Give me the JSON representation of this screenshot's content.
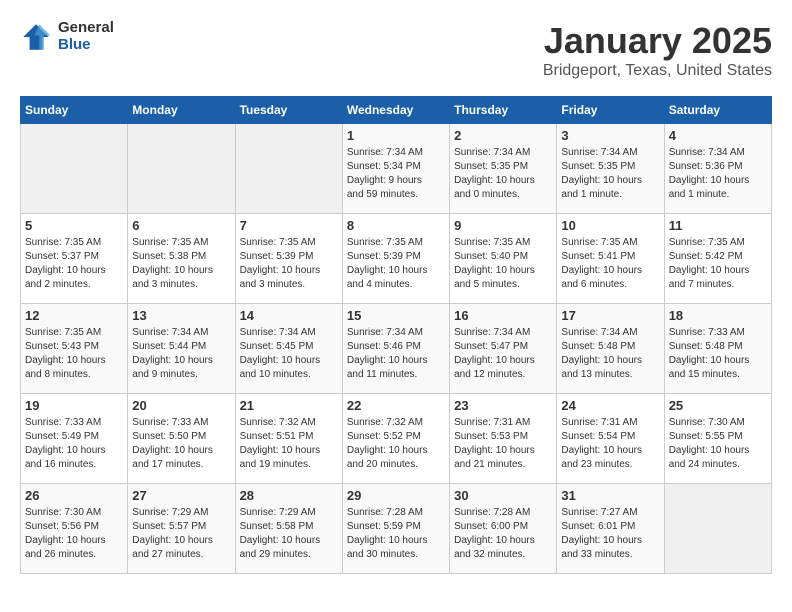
{
  "header": {
    "logo_general": "General",
    "logo_blue": "Blue",
    "title": "January 2025",
    "location": "Bridgeport, Texas, United States"
  },
  "days_of_week": [
    "Sunday",
    "Monday",
    "Tuesday",
    "Wednesday",
    "Thursday",
    "Friday",
    "Saturday"
  ],
  "weeks": [
    [
      {
        "num": "",
        "detail": ""
      },
      {
        "num": "",
        "detail": ""
      },
      {
        "num": "",
        "detail": ""
      },
      {
        "num": "1",
        "detail": "Sunrise: 7:34 AM\nSunset: 5:34 PM\nDaylight: 9 hours\nand 59 minutes."
      },
      {
        "num": "2",
        "detail": "Sunrise: 7:34 AM\nSunset: 5:35 PM\nDaylight: 10 hours\nand 0 minutes."
      },
      {
        "num": "3",
        "detail": "Sunrise: 7:34 AM\nSunset: 5:35 PM\nDaylight: 10 hours\nand 1 minute."
      },
      {
        "num": "4",
        "detail": "Sunrise: 7:34 AM\nSunset: 5:36 PM\nDaylight: 10 hours\nand 1 minute."
      }
    ],
    [
      {
        "num": "5",
        "detail": "Sunrise: 7:35 AM\nSunset: 5:37 PM\nDaylight: 10 hours\nand 2 minutes."
      },
      {
        "num": "6",
        "detail": "Sunrise: 7:35 AM\nSunset: 5:38 PM\nDaylight: 10 hours\nand 3 minutes."
      },
      {
        "num": "7",
        "detail": "Sunrise: 7:35 AM\nSunset: 5:39 PM\nDaylight: 10 hours\nand 3 minutes."
      },
      {
        "num": "8",
        "detail": "Sunrise: 7:35 AM\nSunset: 5:39 PM\nDaylight: 10 hours\nand 4 minutes."
      },
      {
        "num": "9",
        "detail": "Sunrise: 7:35 AM\nSunset: 5:40 PM\nDaylight: 10 hours\nand 5 minutes."
      },
      {
        "num": "10",
        "detail": "Sunrise: 7:35 AM\nSunset: 5:41 PM\nDaylight: 10 hours\nand 6 minutes."
      },
      {
        "num": "11",
        "detail": "Sunrise: 7:35 AM\nSunset: 5:42 PM\nDaylight: 10 hours\nand 7 minutes."
      }
    ],
    [
      {
        "num": "12",
        "detail": "Sunrise: 7:35 AM\nSunset: 5:43 PM\nDaylight: 10 hours\nand 8 minutes."
      },
      {
        "num": "13",
        "detail": "Sunrise: 7:34 AM\nSunset: 5:44 PM\nDaylight: 10 hours\nand 9 minutes."
      },
      {
        "num": "14",
        "detail": "Sunrise: 7:34 AM\nSunset: 5:45 PM\nDaylight: 10 hours\nand 10 minutes."
      },
      {
        "num": "15",
        "detail": "Sunrise: 7:34 AM\nSunset: 5:46 PM\nDaylight: 10 hours\nand 11 minutes."
      },
      {
        "num": "16",
        "detail": "Sunrise: 7:34 AM\nSunset: 5:47 PM\nDaylight: 10 hours\nand 12 minutes."
      },
      {
        "num": "17",
        "detail": "Sunrise: 7:34 AM\nSunset: 5:48 PM\nDaylight: 10 hours\nand 13 minutes."
      },
      {
        "num": "18",
        "detail": "Sunrise: 7:33 AM\nSunset: 5:48 PM\nDaylight: 10 hours\nand 15 minutes."
      }
    ],
    [
      {
        "num": "19",
        "detail": "Sunrise: 7:33 AM\nSunset: 5:49 PM\nDaylight: 10 hours\nand 16 minutes."
      },
      {
        "num": "20",
        "detail": "Sunrise: 7:33 AM\nSunset: 5:50 PM\nDaylight: 10 hours\nand 17 minutes."
      },
      {
        "num": "21",
        "detail": "Sunrise: 7:32 AM\nSunset: 5:51 PM\nDaylight: 10 hours\nand 19 minutes."
      },
      {
        "num": "22",
        "detail": "Sunrise: 7:32 AM\nSunset: 5:52 PM\nDaylight: 10 hours\nand 20 minutes."
      },
      {
        "num": "23",
        "detail": "Sunrise: 7:31 AM\nSunset: 5:53 PM\nDaylight: 10 hours\nand 21 minutes."
      },
      {
        "num": "24",
        "detail": "Sunrise: 7:31 AM\nSunset: 5:54 PM\nDaylight: 10 hours\nand 23 minutes."
      },
      {
        "num": "25",
        "detail": "Sunrise: 7:30 AM\nSunset: 5:55 PM\nDaylight: 10 hours\nand 24 minutes."
      }
    ],
    [
      {
        "num": "26",
        "detail": "Sunrise: 7:30 AM\nSunset: 5:56 PM\nDaylight: 10 hours\nand 26 minutes."
      },
      {
        "num": "27",
        "detail": "Sunrise: 7:29 AM\nSunset: 5:57 PM\nDaylight: 10 hours\nand 27 minutes."
      },
      {
        "num": "28",
        "detail": "Sunrise: 7:29 AM\nSunset: 5:58 PM\nDaylight: 10 hours\nand 29 minutes."
      },
      {
        "num": "29",
        "detail": "Sunrise: 7:28 AM\nSunset: 5:59 PM\nDaylight: 10 hours\nand 30 minutes."
      },
      {
        "num": "30",
        "detail": "Sunrise: 7:28 AM\nSunset: 6:00 PM\nDaylight: 10 hours\nand 32 minutes."
      },
      {
        "num": "31",
        "detail": "Sunrise: 7:27 AM\nSunset: 6:01 PM\nDaylight: 10 hours\nand 33 minutes."
      },
      {
        "num": "",
        "detail": ""
      }
    ]
  ]
}
